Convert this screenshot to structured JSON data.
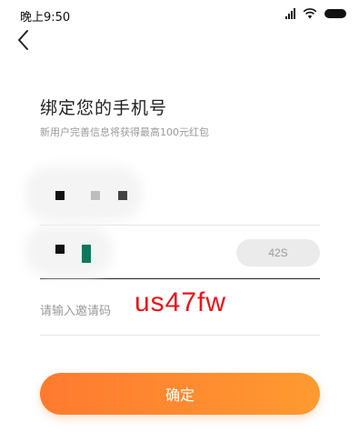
{
  "status_bar": {
    "time": "晚上9:50",
    "icons": [
      "signal-icon",
      "wifi-icon",
      "battery-icon"
    ]
  },
  "header": {
    "back_icon": "chevron-left-icon"
  },
  "main": {
    "title": "绑定您的手机号",
    "subtitle": "新用户完善信息将获得最高100元红包",
    "phone_field": {
      "value": ""
    },
    "code_field": {
      "value": "",
      "countdown_label": "42S"
    },
    "invite_field": {
      "placeholder": "请输入邀请码",
      "handwritten_value": "us47fw"
    },
    "confirm_label": "确定"
  },
  "colors": {
    "accent_start": "#ff7a30",
    "accent_end": "#ff9a30",
    "handwriting": "#e8141a",
    "pixel_teal": "#0a7a5c"
  }
}
